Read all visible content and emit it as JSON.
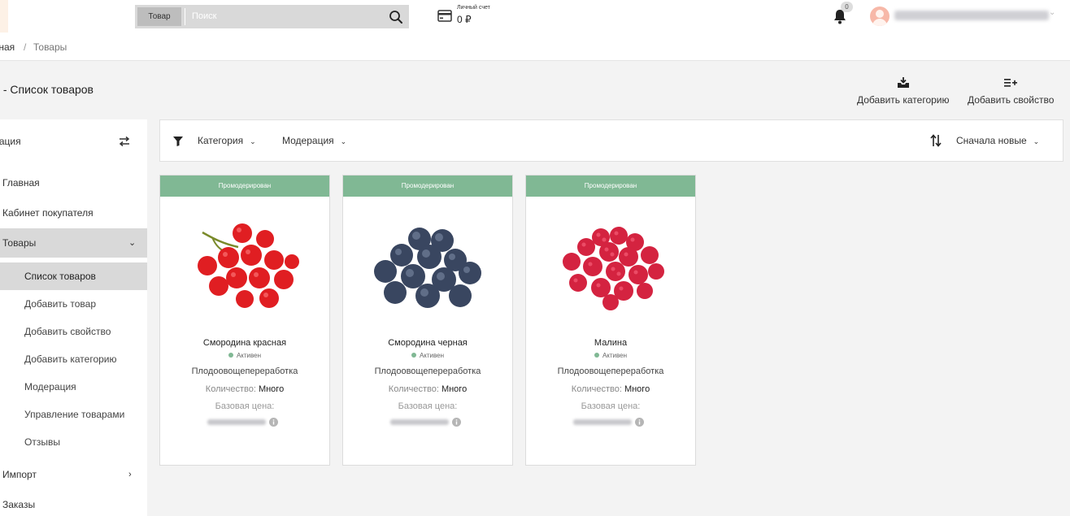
{
  "header": {
    "search_scope": "Товар",
    "search_placeholder": "Поиск",
    "account_label": "Личный счет",
    "account_value": "0 ₽",
    "notifications_count": "0"
  },
  "breadcrumb": {
    "home": "вная",
    "separator": "/",
    "current": "Товары"
  },
  "page_title": {
    "prefix": "ы",
    "rest": " - Список товаров"
  },
  "actions": {
    "add_category": "Добавить категорию",
    "add_property": "Добавить свойство"
  },
  "sidebar": {
    "header": "игация",
    "items": [
      {
        "label": "Главная"
      },
      {
        "label": "Кабинет покупателя"
      },
      {
        "label": "Товары"
      },
      {
        "label": "Импорт"
      },
      {
        "label": "Заказы"
      }
    ],
    "sub_items": [
      {
        "label": "Список товаров"
      },
      {
        "label": "Добавить товар"
      },
      {
        "label": "Добавить свойство"
      },
      {
        "label": "Добавить категорию"
      },
      {
        "label": "Модерация"
      },
      {
        "label": "Управление товарами"
      },
      {
        "label": "Отзывы"
      }
    ]
  },
  "filters": {
    "category": "Категория",
    "moderation": "Модерация",
    "sort": "Сначала новые"
  },
  "products": [
    {
      "status": "Промодерирован",
      "name": "Смородина красная",
      "state": "Активен",
      "category": "Плодоовощепереработка",
      "qty_label": "Количество:",
      "qty_value": "Много",
      "price_label": "Базовая цена:"
    },
    {
      "status": "Промодерирован",
      "name": "Смородина черная",
      "state": "Активен",
      "category": "Плодоовощепереработка",
      "qty_label": "Количество:",
      "qty_value": "Много",
      "price_label": "Базовая цена:"
    },
    {
      "status": "Промодерирован",
      "name": "Малина",
      "state": "Активен",
      "category": "Плодоовощепереработка",
      "qty_label": "Количество:",
      "qty_value": "Много",
      "price_label": "Базовая цена:"
    }
  ],
  "colors": {
    "status_green": "#80b894",
    "active_gray": "#d9d9d9"
  }
}
